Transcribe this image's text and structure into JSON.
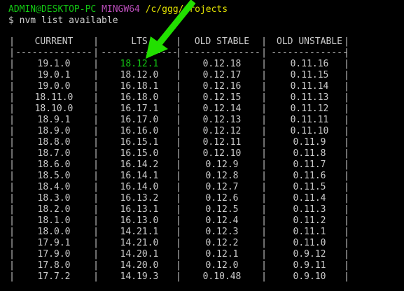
{
  "prompt": {
    "user_host": "ADMIN@DESKTOP-PC",
    "shell": "MINGW64",
    "path": "/c/ggg/projects"
  },
  "command": "$ nvm list available",
  "table": {
    "headers": [
      "CURRENT",
      "LTS",
      "OLD STABLE",
      "OLD UNSTABLE"
    ],
    "dashes": [
      "--------------",
      "--------------",
      "--------------",
      "--------------"
    ],
    "rows": [
      [
        "19.1.0",
        "18.12.1",
        "0.12.18",
        "0.11.16"
      ],
      [
        "19.0.1",
        "18.12.0",
        "0.12.17",
        "0.11.15"
      ],
      [
        "19.0.0",
        "16.18.1",
        "0.12.16",
        "0.11.14"
      ],
      [
        "18.11.0",
        "16.18.0",
        "0.12.15",
        "0.11.13"
      ],
      [
        "18.10.0",
        "16.17.1",
        "0.12.14",
        "0.11.12"
      ],
      [
        "18.9.1",
        "16.17.0",
        "0.12.13",
        "0.11.11"
      ],
      [
        "18.9.0",
        "16.16.0",
        "0.12.12",
        "0.11.10"
      ],
      [
        "18.8.0",
        "16.15.1",
        "0.12.11",
        "0.11.9"
      ],
      [
        "18.7.0",
        "16.15.0",
        "0.12.10",
        "0.11.8"
      ],
      [
        "18.6.0",
        "16.14.2",
        "0.12.9",
        "0.11.7"
      ],
      [
        "18.5.0",
        "16.14.1",
        "0.12.8",
        "0.11.6"
      ],
      [
        "18.4.0",
        "16.14.0",
        "0.12.7",
        "0.11.5"
      ],
      [
        "18.3.0",
        "16.13.2",
        "0.12.6",
        "0.11.4"
      ],
      [
        "18.2.0",
        "16.13.1",
        "0.12.5",
        "0.11.3"
      ],
      [
        "18.1.0",
        "16.13.0",
        "0.12.4",
        "0.11.2"
      ],
      [
        "18.0.0",
        "14.21.1",
        "0.12.3",
        "0.11.1"
      ],
      [
        "17.9.1",
        "14.21.0",
        "0.12.2",
        "0.11.0"
      ],
      [
        "17.9.0",
        "14.20.1",
        "0.12.1",
        "0.9.12"
      ],
      [
        "17.8.0",
        "14.20.0",
        "0.12.0",
        "0.9.11"
      ],
      [
        "17.7.2",
        "14.19.3",
        "0.10.48",
        "0.9.10"
      ]
    ]
  },
  "colors": {
    "background": "#000000",
    "text": "#cccccc",
    "user_host": "#13c813",
    "shell": "#b84cb8",
    "path": "#e0e000",
    "highlight": "#13c813",
    "arrow": "#22e000"
  },
  "annotation": {
    "icon": "arrow-icon",
    "points_to": "18.12.1"
  }
}
